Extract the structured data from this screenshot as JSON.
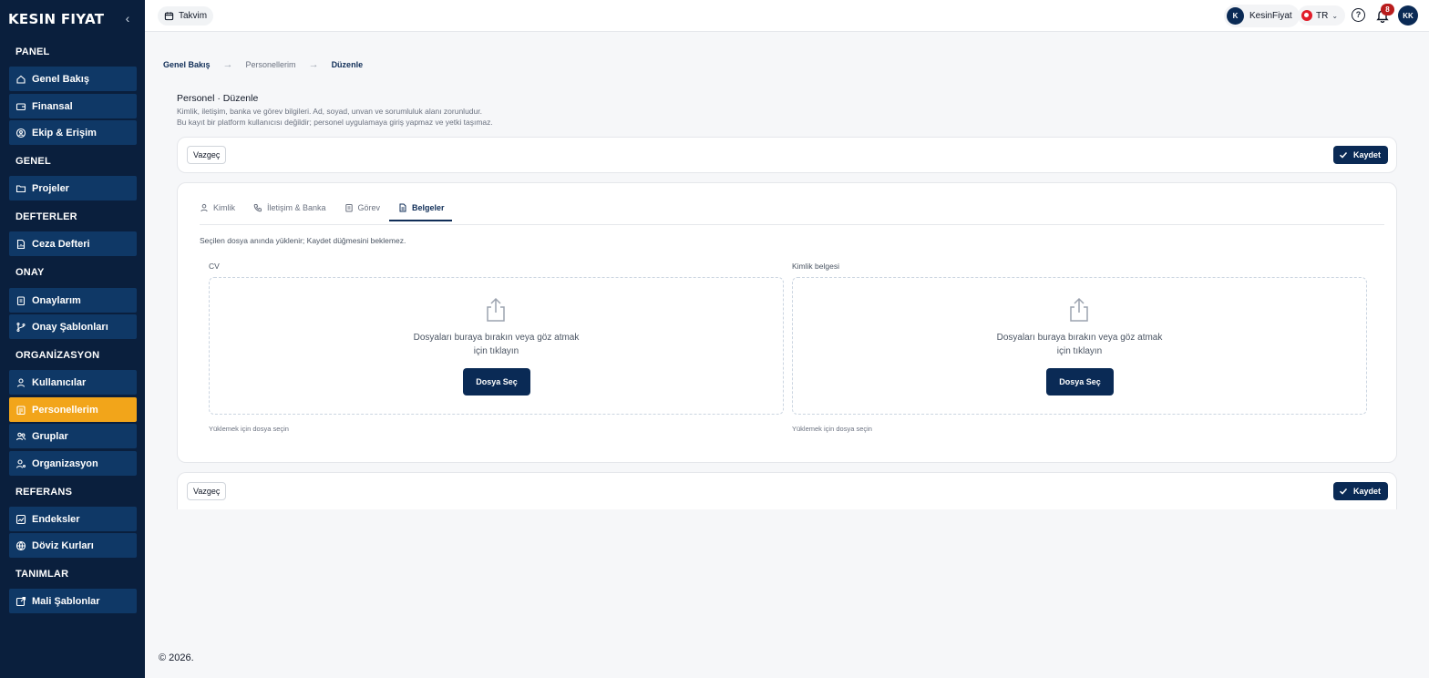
{
  "brand": {
    "name": "KESIN FIYAT"
  },
  "sidebar": {
    "sections": [
      {
        "title": "PANEL",
        "items": [
          {
            "label": "Genel Bakış",
            "icon": "home-icon"
          },
          {
            "label": "Finansal",
            "icon": "wallet-icon"
          },
          {
            "label": "Ekip & Erişim",
            "icon": "shield-user-icon"
          }
        ]
      },
      {
        "title": "GENEL",
        "items": [
          {
            "label": "Projeler",
            "icon": "folder-icon"
          }
        ]
      },
      {
        "title": "DEFTERLER",
        "items": [
          {
            "label": "Ceza Defteri",
            "icon": "file-chart-icon"
          }
        ]
      },
      {
        "title": "ONAY",
        "items": [
          {
            "label": "Onaylarım",
            "icon": "clipboard-icon"
          },
          {
            "label": "Onay Şablonları",
            "icon": "git-branch-icon"
          }
        ]
      },
      {
        "title": "ORGANİZASYON",
        "items": [
          {
            "label": "Kullanıcılar",
            "icon": "user-icon"
          },
          {
            "label": "Personellerim",
            "icon": "badge-icon",
            "active": true
          },
          {
            "label": "Gruplar",
            "icon": "users-icon"
          },
          {
            "label": "Organizasyon",
            "icon": "user-cog-icon"
          }
        ]
      },
      {
        "title": "REFERANS",
        "items": [
          {
            "label": "Endeksler",
            "icon": "trending-icon"
          },
          {
            "label": "Döviz Kurları",
            "icon": "globe-icon"
          }
        ]
      },
      {
        "title": "TANIMLAR",
        "items": [
          {
            "label": "Mali Şablonlar",
            "icon": "external-edit-icon"
          }
        ]
      }
    ]
  },
  "topbar": {
    "calendar_label": "Takvim",
    "user_initial": "K",
    "user_name": "KesinFiyat",
    "language": "TR",
    "notification_count": "8",
    "avatar_initials": "KK"
  },
  "breadcrumb": {
    "items": [
      "Genel Bakış",
      "Personellerim",
      "Düzenle"
    ]
  },
  "page": {
    "title": "Personel · Düzenle",
    "desc_line1": "Kimlik, iletişim, banka ve görev bilgileri. Ad, soyad, unvan ve sorumluluk alanı zorunludur.",
    "desc_line2": "Bu kayıt bir platform kullanıcısı değildir; personel uygulamaya giriş yapmaz ve yetki taşımaz."
  },
  "actions": {
    "cancel": "Vazgeç",
    "save": "Kaydet"
  },
  "tabs": [
    {
      "label": "Kimlik",
      "icon": "user-icon"
    },
    {
      "label": "İletişim & Banka",
      "icon": "phone-icon"
    },
    {
      "label": "Görev",
      "icon": "clipboard-icon"
    },
    {
      "label": "Belgeler",
      "icon": "document-icon",
      "active": true
    }
  ],
  "documents": {
    "hint": "Seçilen dosya anında yüklenir; Kaydet düğmesini beklemez.",
    "fields": [
      {
        "label": "CV",
        "drop_line1": "Dosyaları buraya bırakın veya göz atmak",
        "drop_line2": "için tıklayın",
        "button": "Dosya Seç",
        "status": "Yüklemek için dosya seçin"
      },
      {
        "label": "Kimlik belgesi",
        "drop_line1": "Dosyaları buraya bırakın veya göz atmak",
        "drop_line2": "için tıklayın",
        "button": "Dosya Seç",
        "status": "Yüklemek için dosya seçin"
      }
    ]
  },
  "footer": {
    "text": "© 2026."
  },
  "colors": {
    "sidebar_bg": "#0a1f3d",
    "nav_item_bg": "#0f3866",
    "active_item": "#f2a51a",
    "primary": "#0a2a55",
    "badge": "#b91c1c"
  }
}
